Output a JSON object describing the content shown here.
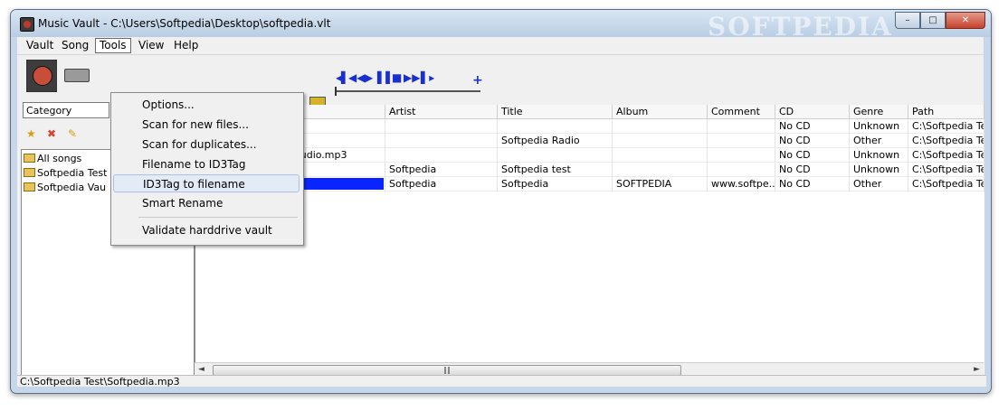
{
  "window": {
    "title": "Music Vault - C:\\Users\\Softpedia\\Desktop\\softpedia.vlt",
    "watermark": "SOFTPEDIA"
  },
  "menu": [
    "Vault",
    "Song",
    "Tools",
    "View",
    "Help"
  ],
  "tools_menu": {
    "items": [
      "Options...",
      "Scan for new files...",
      "Scan for duplicates...",
      "Filename to ID3Tag",
      "ID3Tag to filename",
      "Smart Rename",
      "Validate harddrive vault"
    ],
    "hovered": "ID3Tag to filename"
  },
  "category_input": {
    "value": "Category"
  },
  "tree": {
    "items": [
      "All songs",
      "Softpedia Test",
      "Softpedia Vau"
    ]
  },
  "grid": {
    "columns": [
      "Artist",
      "Title",
      "Album",
      "Comment",
      "CD",
      "Genre",
      "Path"
    ],
    "partial_filename": "audio.mp3",
    "rows": [
      {
        "artist": "",
        "title": "",
        "album": "",
        "comment": "",
        "cd": "No CD",
        "genre": "Unknown",
        "path": "C:\\Softpedia Test\\"
      },
      {
        "artist": "",
        "title": "Softpedia Radio",
        "album": "",
        "comment": "",
        "cd": "No CD",
        "genre": "Other",
        "path": "C:\\Softpedia Test\\"
      },
      {
        "artist": "",
        "title": "",
        "album": "",
        "comment": "",
        "cd": "No CD",
        "genre": "Unknown",
        "path": "C:\\Softpedia Test\\"
      },
      {
        "artist": "Softpedia",
        "title": "Softpedia test",
        "album": "",
        "comment": "",
        "cd": "No CD",
        "genre": "Unknown",
        "path": "C:\\Softpedia Test\\"
      },
      {
        "artist": "Softpedia",
        "title": "Softpedia",
        "album": "SOFTPEDIA",
        "comment": "www.softpe...",
        "cd": "No CD",
        "genre": "Other",
        "path": "C:\\Softpedia Test\\"
      }
    ],
    "selected_row": 4
  },
  "statusbar": {
    "text": "C:\\Softpedia Test\\Softpedia.mp3"
  }
}
